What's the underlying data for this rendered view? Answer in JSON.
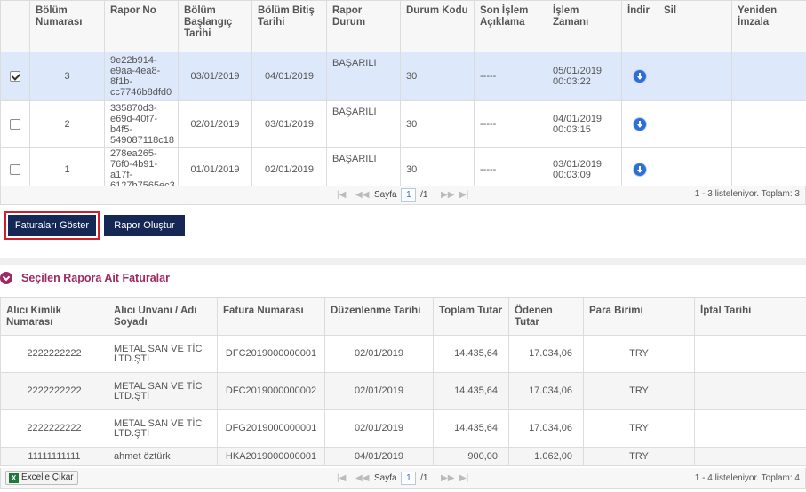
{
  "reports": {
    "headers": {
      "section_no": "Bölüm Numarası",
      "report_no": "Rapor No",
      "start_date": "Bölüm Başlangıç Tarihi",
      "end_date": "Bölüm Bitiş Tarihi",
      "status": "Rapor Durum",
      "status_code": "Durum Kodu",
      "last_op": "Son İşlem Açıklama",
      "op_time": "İşlem Zamanı",
      "download": "İndir",
      "delete": "Sil",
      "resign": "Yeniden İmzala"
    },
    "rows": [
      {
        "selected": true,
        "section": "3",
        "report_no": "9e22b914-e9aa-4ea8-8f1b-cc7746b8dfd0",
        "start": "03/01/2019",
        "end": "04/01/2019",
        "status": "BAŞARILI",
        "code": "30",
        "last_op": "-----",
        "time": "05/01/2019 00:03:22"
      },
      {
        "selected": false,
        "section": "2",
        "report_no": "335870d3-e69d-40f7-b4f5-549087118c18",
        "start": "02/01/2019",
        "end": "03/01/2019",
        "status": "BAŞARILI",
        "code": "30",
        "last_op": "-----",
        "time": "04/01/2019 00:03:15"
      },
      {
        "selected": false,
        "section": "1",
        "report_no": "278ea265-76f0-4b91-a17f-6127b7565ec3",
        "start": "01/01/2019",
        "end": "02/01/2019",
        "status": "BAŞARILI",
        "code": "30",
        "last_op": "-----",
        "time": "03/01/2019 00:03:09"
      }
    ],
    "pager": {
      "page_label": "Sayfa",
      "page": "1",
      "of": "/1",
      "info": "1 - 3 listeleniyor. Toplam: 3"
    }
  },
  "buttons": {
    "show_invoices": "Faturaları Göster",
    "create_report": "Rapor Oluştur"
  },
  "invoices": {
    "section_title": "Seçilen Rapora Ait Faturalar",
    "headers": {
      "buyer_id": "Alıcı Kimlik Numarası",
      "buyer_name": "Alıcı Unvanı / Adı Soyadı",
      "invoice_no": "Fatura Numarası",
      "issue_date": "Düzenlenme Tarihi",
      "total": "Toplam Tutar",
      "paid": "Ödenen Tutar",
      "currency": "Para Birimi",
      "cancel_date": "İptal Tarihi"
    },
    "rows": [
      {
        "buyer_id": "2222222222",
        "buyer_name": "METAL SAN VE TİC LTD.ŞTİ",
        "invoice_no": "DFC2019000000001",
        "issue_date": "02/01/2019",
        "total": "14.435,64",
        "paid": "17.034,06",
        "currency": "TRY",
        "cancel_date": ""
      },
      {
        "buyer_id": "2222222222",
        "buyer_name": "METAL SAN VE TİC LTD.ŞTİ",
        "invoice_no": "DFC2019000000002",
        "issue_date": "02/01/2019",
        "total": "14.435,64",
        "paid": "17.034,06",
        "currency": "TRY",
        "cancel_date": ""
      },
      {
        "buyer_id": "2222222222",
        "buyer_name": "METAL SAN VE TİC LTD.ŞTİ",
        "invoice_no": "DFG2019000000001",
        "issue_date": "02/01/2019",
        "total": "14.435,64",
        "paid": "17.034,06",
        "currency": "TRY",
        "cancel_date": ""
      },
      {
        "buyer_id": "11111111111",
        "buyer_name": "ahmet öztürk",
        "invoice_no": "HKA2019000000001",
        "issue_date": "04/01/2019",
        "total": "900,00",
        "paid": "1.062,00",
        "currency": "TRY",
        "cancel_date": ""
      }
    ],
    "excel_label": "Excel'e Çıkar",
    "pager": {
      "page_label": "Sayfa",
      "page": "1",
      "of": "/1",
      "info": "1 - 4 listeleniyor. Toplam: 4"
    }
  },
  "icons": {
    "download": "download-circle-icon",
    "section_toggle": "chevron-down-circle-icon",
    "excel": "excel-icon",
    "pager_first": "first-page-icon",
    "pager_prev": "prev-page-icon",
    "pager_next": "next-page-icon",
    "pager_last": "last-page-icon"
  },
  "colors": {
    "selected_row": "#dde9fb",
    "button_bg": "#142755",
    "highlight_border": "#d01f2c",
    "section_title": "#9c2a63",
    "download_icon": "#2e6fd6"
  }
}
